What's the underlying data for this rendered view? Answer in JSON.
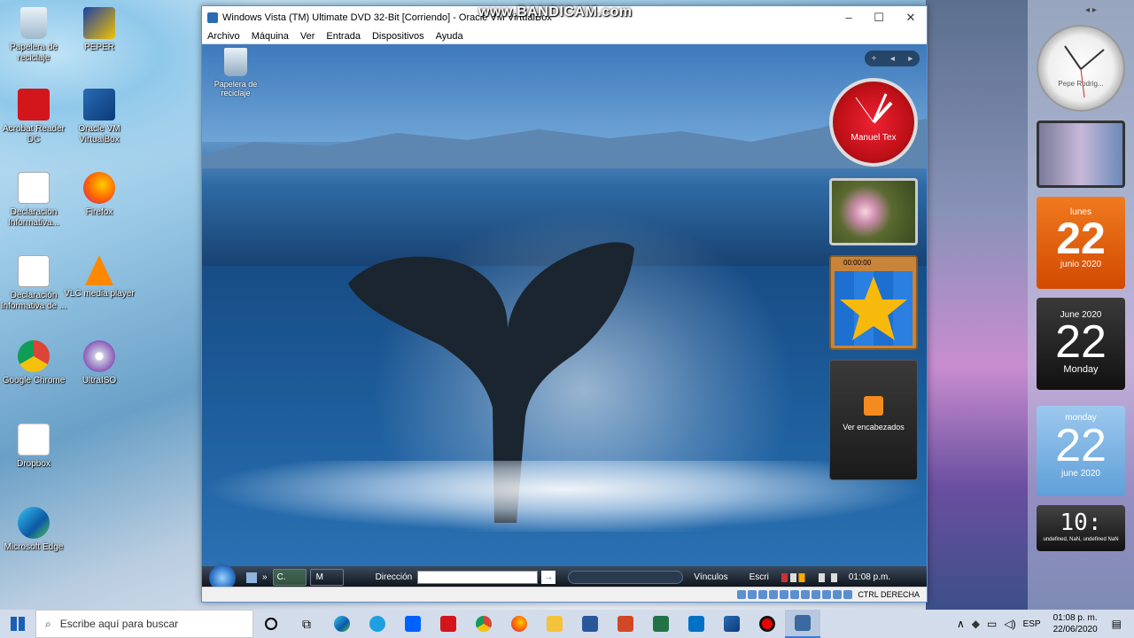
{
  "host_desktop": {
    "icons": [
      {
        "label": "Papelera de reciclaje",
        "icon": "recycle-bin-icon"
      },
      {
        "label": "PEPER",
        "icon": "peper-icon"
      },
      {
        "label": "Acrobat Reader DC",
        "icon": "acrobat-icon"
      },
      {
        "label": "Oracle VM VirtualBox",
        "icon": "virtualbox-icon"
      },
      {
        "label": "Declaracion Informativa...",
        "icon": "sat-icon"
      },
      {
        "label": "Firefox",
        "icon": "firefox-icon"
      },
      {
        "label": "Declaración Informativa de ...",
        "icon": "sat-icon"
      },
      {
        "label": "VLC media player",
        "icon": "vlc-icon"
      },
      {
        "label": "Google Chrome",
        "icon": "chrome-icon"
      },
      {
        "label": "UltraISO",
        "icon": "ultraiso-icon"
      },
      {
        "label": "Dropbox",
        "icon": "dropbox-icon"
      },
      {
        "label": "Microsoft Edge",
        "icon": "edge-icon"
      }
    ]
  },
  "watermark": "www.BANDICAM.com",
  "vm": {
    "title": "Windows Vista (TM) Ultimate DVD 32-Bit [Corriendo] - Oracle VM VirtualBox",
    "menu": [
      "Archivo",
      "Máquina",
      "Ver",
      "Entrada",
      "Dispositivos",
      "Ayuda"
    ],
    "guest": {
      "desktop_icon": "Papelera de reciclaje",
      "clock_label": "Manuel Tex",
      "puzzle_time": "00:00:00",
      "feed_label": "Ver encabezados",
      "taskbar": {
        "task1": "C.",
        "task2": "M",
        "address_label": "Dirección",
        "links": "Vínculos",
        "write": "Escri",
        "time": "01:08 p.m."
      }
    },
    "status": "CTRL DERECHA"
  },
  "right_gadgets": {
    "clock_label": "Pepe Rodrig...",
    "cal1": {
      "weekday": "lunes",
      "day": "22",
      "month": "junio 2020"
    },
    "cal2": {
      "header": "June 2020",
      "day": "22",
      "weekday": "Monday"
    },
    "cal3": {
      "weekday": "monday",
      "day": "22",
      "month": "june 2020"
    },
    "digital": {
      "time": "10:",
      "sub": "undefined, NaN, undefined NaN"
    }
  },
  "host_taskbar": {
    "search_placeholder": "Escribe aquí para buscar",
    "lang": "ESP",
    "time": "01:08 p. m.",
    "date": "22/06/2020"
  }
}
